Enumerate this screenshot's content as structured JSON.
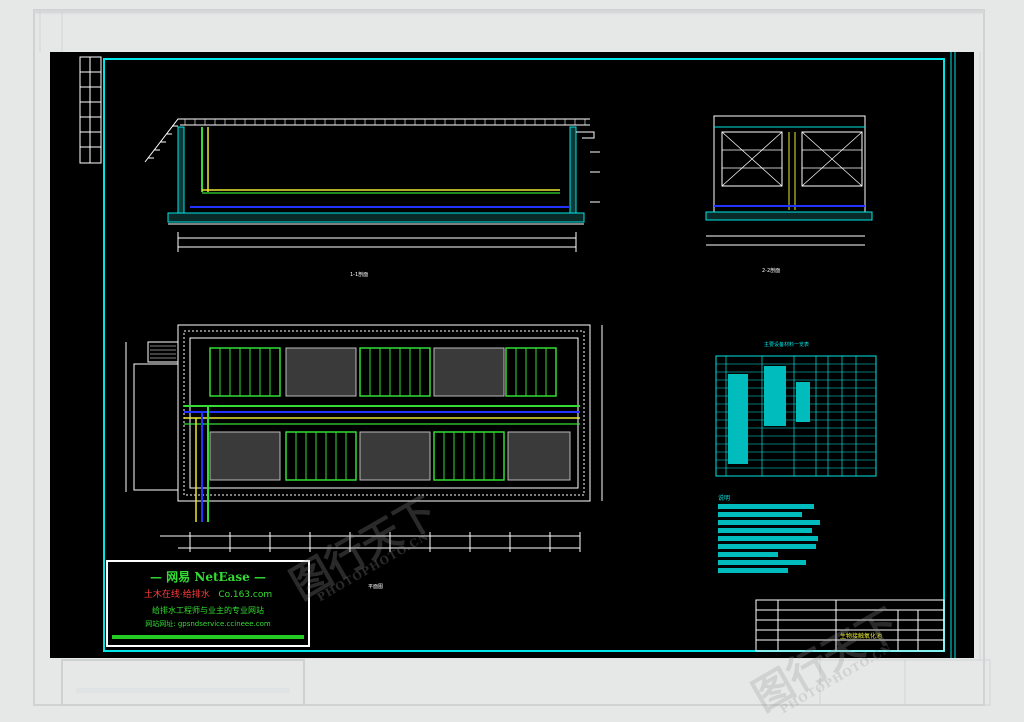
{
  "drawing": {
    "section_title_1": "1-1剖面",
    "section_title_2": "2-2剖面",
    "plan_title": "平面图",
    "table_title": "主要设备材料一览表",
    "notes_title": "说明",
    "title_block_name": "生物接触氧化池"
  },
  "stamp": {
    "brand": "— 网易 NetEase —",
    "section": "土木在线·给排水",
    "site": "Co.163.com",
    "slogan": "给排水工程师与业主的专业网站",
    "url": "网站网址: gpsndservice.ccineee.com"
  },
  "watermark": {
    "text": "图行天下",
    "sub": "PHOTOPHOTO.CN"
  },
  "colors": {
    "background": "#e6e8e8",
    "canvas": "#000000",
    "cyan": "#00e5e5",
    "green": "#33dd33",
    "yellow": "#e8e832",
    "white": "#ffffff"
  }
}
